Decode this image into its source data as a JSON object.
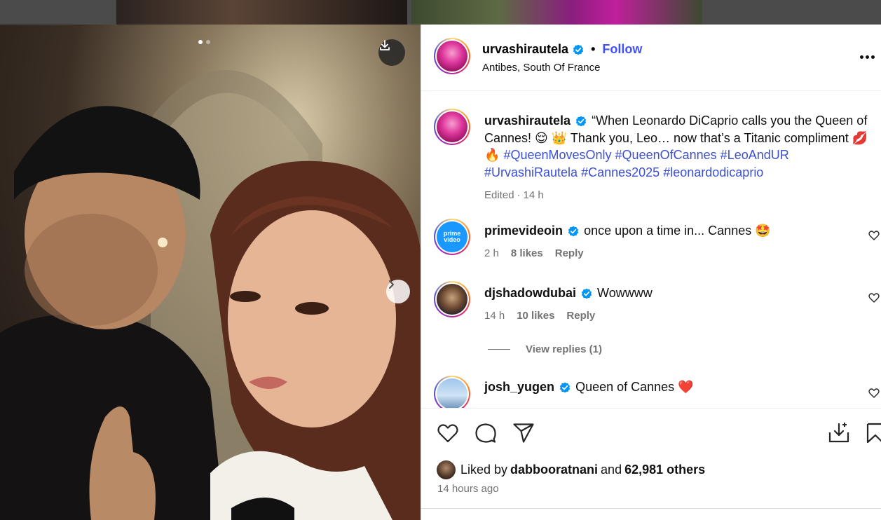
{
  "post": {
    "username": "urvashirautela",
    "separator": "•",
    "follow_label": "Follow",
    "location": "Antibes, South Of France",
    "caption": {
      "username": "urvashirautela",
      "text_before": "“When Leonardo DiCaprio calls you the Queen of Cannes! 😌 👑 Thank you, Leo… now that’s a Titanic compliment 💋 🔥",
      "hashtags": [
        "#QueenMovesOnly",
        "#QueenOfCannes",
        "#LeoAndUR",
        "#UrvashiRautela",
        "#Cannes2025",
        "#leonardodicaprio"
      ],
      "edited": "Edited",
      "meta_sep": "·",
      "time": "14 h"
    },
    "carousel": {
      "index": 1,
      "total": 2
    }
  },
  "comments": [
    {
      "username": "primevideoin",
      "text": "once upon a time in... Cannes 🤩",
      "time": "2 h",
      "likes": "8 likes",
      "reply": "Reply",
      "avatar_text_1": "prime",
      "avatar_text_2": "video"
    },
    {
      "username": "djshadowdubai",
      "text": "Wowwww",
      "time": "14 h",
      "likes": "10 likes",
      "reply": "Reply",
      "view_replies": "View replies (1)"
    },
    {
      "username": "josh_yugen",
      "text": "Queen of Cannes ❤️"
    }
  ],
  "footer": {
    "liked_by_prefix": "Liked by",
    "liked_by_user": "dabbooratnani",
    "liked_by_and": "and",
    "liked_by_count": "62,981 others",
    "timestamp": "14 hours ago"
  },
  "icons": {
    "download": "download-icon",
    "next": "chevron-right-icon",
    "more": "more-options-icon",
    "like": "heart-icon",
    "comment": "comment-icon",
    "share": "share-icon",
    "save_to_device": "save-download-icon",
    "bookmark": "bookmark-icon"
  },
  "colors": {
    "link": "#4150f7",
    "hashtag": "#3b4fd1",
    "verified": "#0095f6",
    "muted": "#737373"
  }
}
